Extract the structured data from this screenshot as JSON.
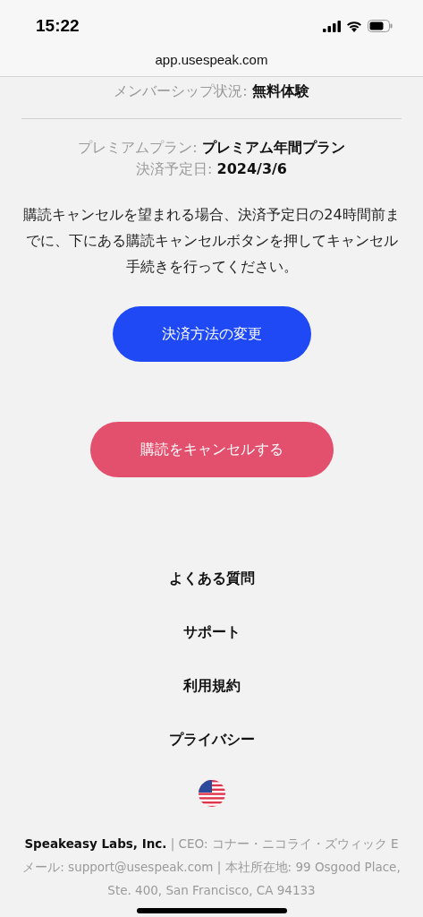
{
  "status_bar": {
    "time": "15:22"
  },
  "address_bar": {
    "url": "app.usespeak.com"
  },
  "membership": {
    "label": "メンバーシップ状況:",
    "value": "無料体験"
  },
  "plan": {
    "label": "プレミアムプラン:",
    "value": "プレミアム年間プラン"
  },
  "payment_date": {
    "label": "決済予定日:",
    "value": "2024/3/6"
  },
  "notice": "購読キャンセルを望まれる場合、決済予定日の24時間前までに、下にある購読キャンセルボタンを押してキャンセル手続きを行ってください。",
  "buttons": [
    {
      "label": "決済方法の変更",
      "kind": "primary"
    },
    {
      "label": "購読をキャンセルする",
      "kind": "danger"
    }
  ],
  "footer_links": [
    "よくある質問",
    "サポート",
    "利用規約",
    "プライバシー"
  ],
  "footer_text": "**Speakeasy Labs, Inc.** | CEO: コナー・ニコライ・ズウィック Eメール: support@usespeak.com | 本社所在地: 99 Osgood Place, Ste. 400, San Francisco, CA 94133"
}
